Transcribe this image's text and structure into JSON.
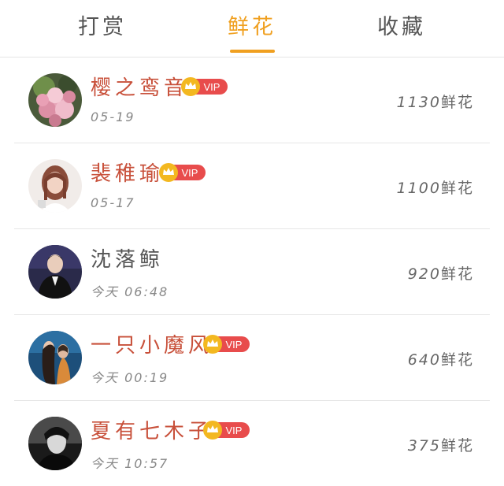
{
  "tabs": [
    {
      "label": "打赏",
      "active": false
    },
    {
      "label": "鲜花",
      "active": true
    },
    {
      "label": "收藏",
      "active": false
    }
  ],
  "colors": {
    "accent": "#f0a020",
    "vip_name": "#c8503a",
    "vip_badge": "#e84c4c",
    "crown": "#f3b820"
  },
  "vip_badge_text": "VIP",
  "unit": "鲜花",
  "rows": [
    {
      "name": "樱之鸾音",
      "vip": true,
      "date": "05-19",
      "count": "1130",
      "avatar": "flower-avatar"
    },
    {
      "name": "裴稚瑜",
      "vip": true,
      "date": "05-17",
      "count": "1100",
      "avatar": "girl-avatar"
    },
    {
      "name": "沈落鲸",
      "vip": false,
      "date": "今天 06:48",
      "count": "920",
      "avatar": "man-suit-avatar"
    },
    {
      "name": "一只小魔风",
      "vip": true,
      "date": "今天 00:19",
      "count": "640",
      "avatar": "couple-avatar"
    },
    {
      "name": "夏有七木子",
      "vip": true,
      "date": "今天 10:57",
      "count": "375",
      "avatar": "dark-portrait-avatar"
    }
  ]
}
